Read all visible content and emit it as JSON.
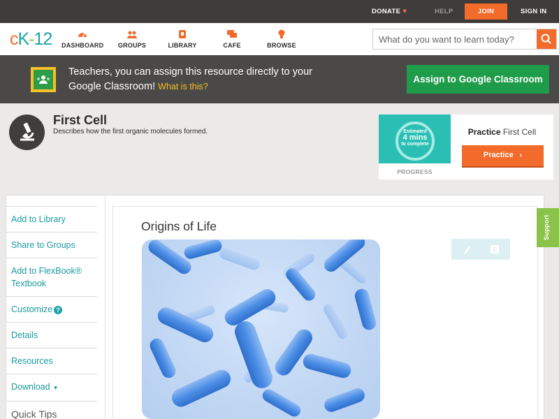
{
  "topbar": {
    "donate": "DONATE",
    "help": "HELP",
    "join": "JOIN",
    "signin": "SIGN IN"
  },
  "nav": {
    "logo": {
      "c": "c",
      "k": "K",
      "dash": "-",
      "num": "12"
    },
    "items": [
      {
        "label": "DASHBOARD",
        "icon": "dashboard-icon"
      },
      {
        "label": "GROUPS",
        "icon": "groups-icon"
      },
      {
        "label": "LIBRARY",
        "icon": "library-icon"
      },
      {
        "label": "CAFE",
        "icon": "cafe-icon"
      },
      {
        "label": "BROWSE",
        "icon": "browse-icon"
      }
    ],
    "search_placeholder": "What do you want to learn today?"
  },
  "banner": {
    "message": "Teachers, you can assign this resource directly to your Google Classroom!",
    "what_link": "What is this?",
    "assign_button": "Assign to Google Classroom"
  },
  "concept": {
    "title": "First Cell",
    "description": "Describes how the first organic molecules formed."
  },
  "practice": {
    "estimated": "Estimated",
    "minutes": "4 mins",
    "to_complete": "to complete",
    "progress_label": "PROGRESS",
    "name_bold": "Practice",
    "name_rest": "First Cell",
    "button": "Practice"
  },
  "sidebar": {
    "items": [
      {
        "label": "Add to Library"
      },
      {
        "label": "Share to Groups"
      },
      {
        "label": "Add to FlexBook® Textbook"
      },
      {
        "label": "Customize"
      },
      {
        "label": "Details"
      },
      {
        "label": "Resources"
      },
      {
        "label": "Download"
      },
      {
        "label": "Quick Tips"
      }
    ]
  },
  "content": {
    "title": "Origins of Life"
  },
  "support": "Support",
  "colors": {
    "accent_orange": "#f26b2a",
    "teal": "#1aa3a8",
    "green": "#1f9c4a",
    "support_green": "#8bc34a"
  }
}
